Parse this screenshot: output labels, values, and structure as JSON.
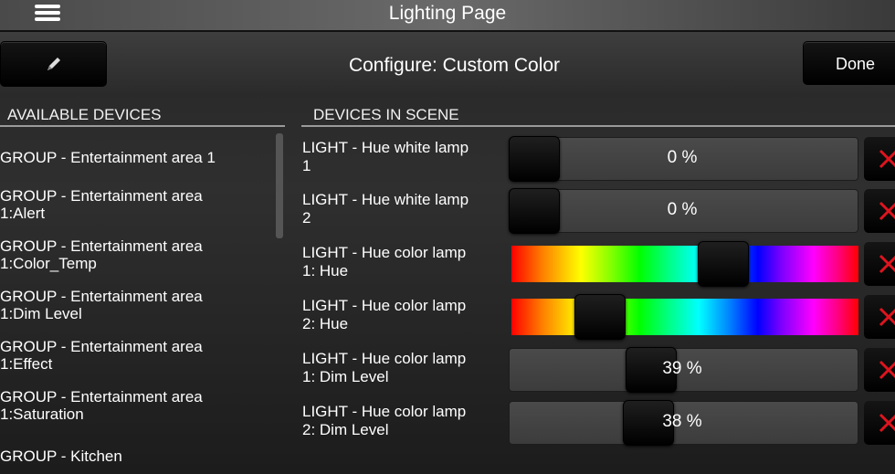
{
  "header": {
    "title": "Lighting Page",
    "menu_icon": "hamburger-menu-icon"
  },
  "config": {
    "title": "Configure: Custom Color",
    "done_label": "Done",
    "edit_icon": "pencil-icon"
  },
  "available": {
    "heading": "AVAILABLE DEVICES",
    "items": [
      {
        "line1": "GROUP - Entertainment area 1",
        "line2": ""
      },
      {
        "line1": "GROUP - Entertainment area",
        "line2": "1:Alert"
      },
      {
        "line1": "GROUP - Entertainment area",
        "line2": "1:Color_Temp"
      },
      {
        "line1": "GROUP - Entertainment area",
        "line2": "1:Dim Level"
      },
      {
        "line1": "GROUP - Entertainment area",
        "line2": "1:Effect"
      },
      {
        "line1": "GROUP - Entertainment area",
        "line2": "1:Saturation"
      },
      {
        "line1": "GROUP - Kitchen",
        "line2": ""
      }
    ]
  },
  "scene": {
    "heading": "DEVICES IN SCENE",
    "rows": [
      {
        "line1": "LIGHT - Hue white lamp",
        "line2": "1",
        "type": "percent",
        "value_text": "0 %",
        "level": 0.0
      },
      {
        "line1": "LIGHT - Hue white lamp",
        "line2": "2",
        "type": "percent",
        "value_text": "0 %",
        "level": 0.0
      },
      {
        "line1": "LIGHT - Hue color lamp",
        "line2": "1: Hue",
        "type": "hue",
        "value_text": "",
        "level": 0.63
      },
      {
        "line1": "LIGHT - Hue color lamp",
        "line2": "2: Hue",
        "type": "hue",
        "value_text": "",
        "level": 0.22
      },
      {
        "line1": "LIGHT - Hue color lamp",
        "line2": "1: Dim Level",
        "type": "percent",
        "value_text": "39 %",
        "level": 0.39
      },
      {
        "line1": "LIGHT - Hue color lamp",
        "line2": "2: Dim Level",
        "type": "percent",
        "value_text": "38 %",
        "level": 0.38
      }
    ],
    "delete_icon": "red-x-icon",
    "delete_color": "#e0141e"
  }
}
